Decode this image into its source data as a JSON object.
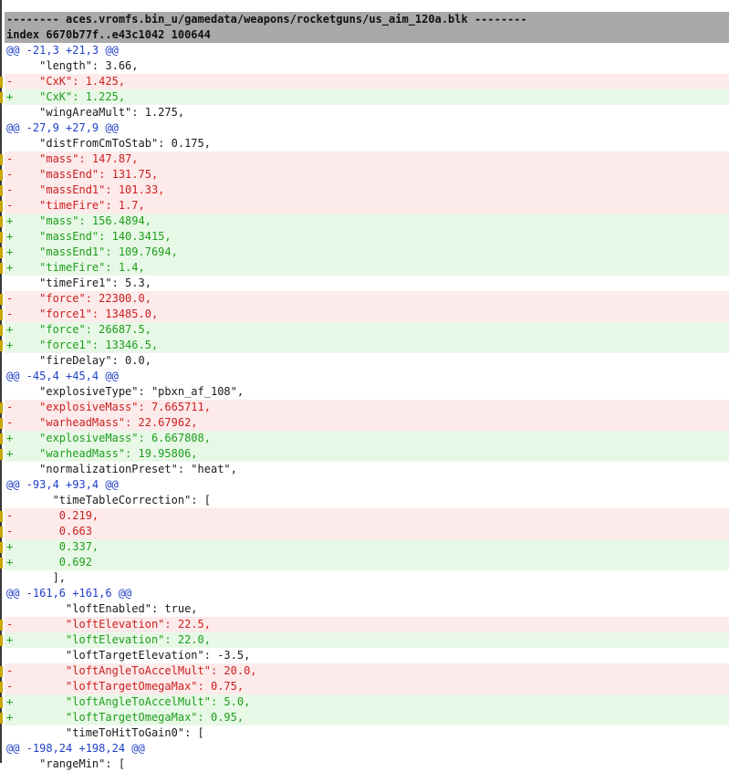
{
  "diff": {
    "lines": [
      {
        "type": "header",
        "text": "-------- aces.vromfs.bin_u/gamedata/weapons/rocketguns/us_aim_120a.blk --------"
      },
      {
        "type": "header",
        "text": "index 6670b77f..e43c1042 100644"
      },
      {
        "type": "hunk",
        "text": "@@ -21,3 +21,3 @@"
      },
      {
        "type": "ctx",
        "text": "     \"length\": 3.66,"
      },
      {
        "type": "del",
        "text": "-    \"CxK\": 1.425,"
      },
      {
        "type": "add",
        "text": "+    \"CxK\": 1.225,"
      },
      {
        "type": "ctx",
        "text": "     \"wingAreaMult\": 1.275,"
      },
      {
        "type": "hunk",
        "text": "@@ -27,9 +27,9 @@"
      },
      {
        "type": "ctx",
        "text": "     \"distFromCmToStab\": 0.175,"
      },
      {
        "type": "del",
        "text": "-    \"mass\": 147.87,"
      },
      {
        "type": "del",
        "text": "-    \"massEnd\": 131.75,"
      },
      {
        "type": "del",
        "text": "-    \"massEnd1\": 101.33,"
      },
      {
        "type": "del",
        "text": "-    \"timeFire\": 1.7,"
      },
      {
        "type": "add",
        "text": "+    \"mass\": 156.4894,"
      },
      {
        "type": "add",
        "text": "+    \"massEnd\": 140.3415,"
      },
      {
        "type": "add",
        "text": "+    \"massEnd1\": 109.7694,"
      },
      {
        "type": "add",
        "text": "+    \"timeFire\": 1.4,"
      },
      {
        "type": "ctx",
        "text": "     \"timeFire1\": 5.3,"
      },
      {
        "type": "del",
        "text": "-    \"force\": 22300.0,"
      },
      {
        "type": "del",
        "text": "-    \"force1\": 13485.0,"
      },
      {
        "type": "add",
        "text": "+    \"force\": 26687.5,"
      },
      {
        "type": "add",
        "text": "+    \"force1\": 13346.5,"
      },
      {
        "type": "ctx",
        "text": "     \"fireDelay\": 0.0,"
      },
      {
        "type": "hunk",
        "text": "@@ -45,4 +45,4 @@"
      },
      {
        "type": "ctx",
        "text": "     \"explosiveType\": \"pbxn_af_108\","
      },
      {
        "type": "del",
        "text": "-    \"explosiveMass\": 7.665711,"
      },
      {
        "type": "del",
        "text": "-    \"warheadMass\": 22.67962,"
      },
      {
        "type": "add",
        "text": "+    \"explosiveMass\": 6.667808,"
      },
      {
        "type": "add",
        "text": "+    \"warheadMass\": 19.95806,"
      },
      {
        "type": "ctx",
        "text": "     \"normalizationPreset\": \"heat\","
      },
      {
        "type": "hunk",
        "text": "@@ -93,4 +93,4 @@"
      },
      {
        "type": "ctx",
        "text": "       \"timeTableCorrection\": ["
      },
      {
        "type": "del",
        "text": "-       0.219,"
      },
      {
        "type": "del",
        "text": "-       0.663"
      },
      {
        "type": "add",
        "text": "+       0.337,"
      },
      {
        "type": "add",
        "text": "+       0.692"
      },
      {
        "type": "ctx",
        "text": "       ],"
      },
      {
        "type": "hunk",
        "text": "@@ -161,6 +161,6 @@"
      },
      {
        "type": "ctx",
        "text": "         \"loftEnabled\": true,"
      },
      {
        "type": "del",
        "text": "-        \"loftElevation\": 22.5,"
      },
      {
        "type": "add",
        "text": "+        \"loftElevation\": 22.0,"
      },
      {
        "type": "ctx",
        "text": "         \"loftTargetElevation\": -3.5,"
      },
      {
        "type": "del",
        "text": "-        \"loftAngleToAccelMult\": 20.0,"
      },
      {
        "type": "del",
        "text": "-        \"loftTargetOmegaMax\": 0.75,"
      },
      {
        "type": "add",
        "text": "+        \"loftAngleToAccelMult\": 5.0,"
      },
      {
        "type": "add",
        "text": "+        \"loftTargetOmegaMax\": 0.95,"
      },
      {
        "type": "ctx",
        "text": "         \"timeToHitToGain0\": ["
      },
      {
        "type": "hunk",
        "text": "@@ -198,24 +198,24 @@"
      },
      {
        "type": "ctx",
        "text": "     \"rangeMin\": ["
      }
    ]
  }
}
